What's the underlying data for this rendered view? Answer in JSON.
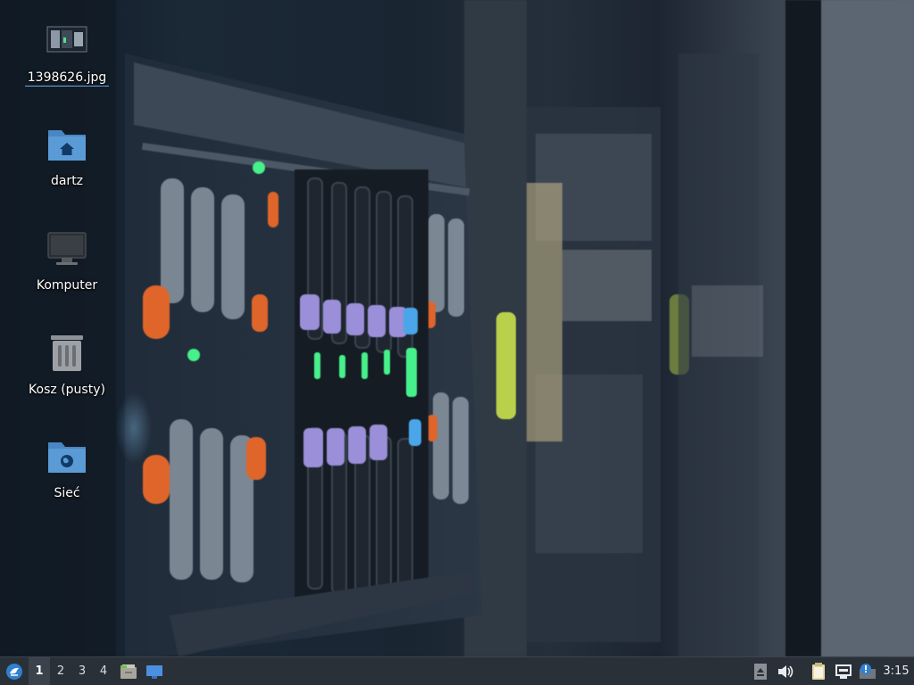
{
  "desktop": {
    "icons": [
      {
        "label": "1398626.jpg",
        "icon": "image-file-icon"
      },
      {
        "label": "dartz",
        "icon": "home-folder-icon"
      },
      {
        "label": "Komputer",
        "icon": "computer-monitor-icon"
      },
      {
        "label": "Kosz (pusty)",
        "icon": "trash-empty-icon"
      },
      {
        "label": "Sieć",
        "icon": "network-folder-icon"
      }
    ]
  },
  "panel": {
    "menu_icon": "application-menu-icon",
    "workspaces": [
      "1",
      "2",
      "3",
      "4"
    ],
    "active_workspace": "1",
    "launchers": [
      "file-manager-icon",
      "show-desktop-icon"
    ],
    "tray": [
      "eject-icon",
      "volume-icon",
      "clipboard-icon",
      "network-wired-icon",
      "update-notifier-icon"
    ],
    "clock": "3:15"
  },
  "colors": {
    "panel_bg": "#2a3038",
    "folder_blue": "#5b9bd5",
    "accent": "#2f80d1"
  }
}
